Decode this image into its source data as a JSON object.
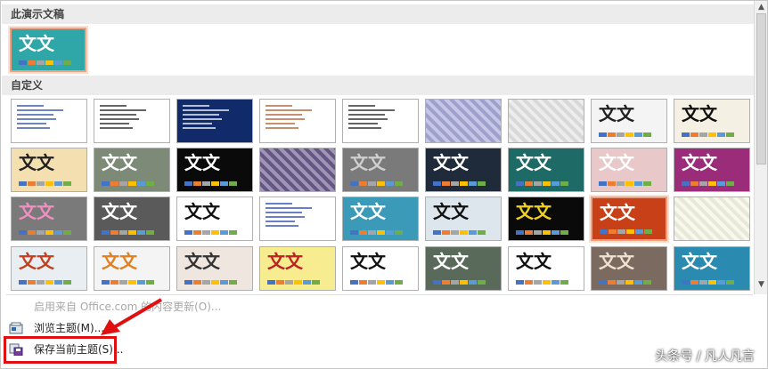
{
  "sections": {
    "current": "此演示文稿",
    "custom": "自定义"
  },
  "current_theme": {
    "text": "文文",
    "bg": "#2fa6a8",
    "color": "#ffffff"
  },
  "themes": [
    {
      "kind": "lines",
      "bg": "#ffffff",
      "line": "#3050a0"
    },
    {
      "kind": "lines",
      "bg": "#ffffff",
      "line": "#222222"
    },
    {
      "kind": "lines",
      "bg": "#102a6a",
      "line": "#ffffff"
    },
    {
      "kind": "lines",
      "bg": "#ffffff",
      "line": "#b06030"
    },
    {
      "kind": "lines",
      "bg": "#ffffff",
      "line": "#222222"
    },
    {
      "kind": "pattern",
      "bg": "#a8a8d8"
    },
    {
      "kind": "pattern",
      "bg": "#e4e4e4"
    },
    {
      "kind": "text",
      "text": "文文",
      "bg": "#f4f4f4",
      "color": "#222222"
    },
    {
      "kind": "text",
      "text": "文文",
      "bg": "#f4f0e4",
      "color": "#111111"
    },
    {
      "kind": "text",
      "text": "文文",
      "bg": "#f3dfb0",
      "color": "#222222"
    },
    {
      "kind": "text",
      "text": "文文",
      "bg": "#7e8a78",
      "color": "#ffffff"
    },
    {
      "kind": "text",
      "text": "文文",
      "bg": "#0a0a0a",
      "color": "#ffffff"
    },
    {
      "kind": "pattern",
      "bg": "#6a5a8a"
    },
    {
      "kind": "text",
      "text": "文文",
      "bg": "#7a7a7a",
      "color": "#cfcfcf"
    },
    {
      "kind": "text",
      "text": "文文",
      "bg": "#1f2a3a",
      "color": "#ffffff"
    },
    {
      "kind": "text",
      "text": "文文",
      "bg": "#1e6a66",
      "color": "#ffffff"
    },
    {
      "kind": "text",
      "text": "文文",
      "bg": "#e8c8c8",
      "color": "#ffffff"
    },
    {
      "kind": "text",
      "text": "文文",
      "bg": "#9a2c7a",
      "color": "#ffffff"
    },
    {
      "kind": "text",
      "text": "文文",
      "bg": "#7a7a7a",
      "color": "#f090c0"
    },
    {
      "kind": "text",
      "text": "文文",
      "bg": "#5a5a5a",
      "color": "#ffffff"
    },
    {
      "kind": "text",
      "text": "文文",
      "bg": "#ffffff",
      "color": "#111111"
    },
    {
      "kind": "lines",
      "bg": "#ffffff",
      "line": "#2a4ab0"
    },
    {
      "kind": "text",
      "text": "文文",
      "bg": "#3a9ab8",
      "color": "#ffffff"
    },
    {
      "kind": "text",
      "text": "文文",
      "bg": "#dce6ec",
      "color": "#111111"
    },
    {
      "kind": "text",
      "text": "文文",
      "bg": "#0a0a0a",
      "color": "#f0d020"
    },
    {
      "kind": "text",
      "text": "文文",
      "bg": "#c84018",
      "color": "#ffffff"
    },
    {
      "kind": "pattern",
      "bg": "#f4f4e4"
    },
    {
      "kind": "text",
      "text": "文文",
      "bg": "#e8eef2",
      "color": "#c04020"
    },
    {
      "kind": "text",
      "text": "文文",
      "bg": "#f4f4f4",
      "color": "#e08020"
    },
    {
      "kind": "text",
      "text": "文文",
      "bg": "#f0e6e0",
      "color": "#333333"
    },
    {
      "kind": "text",
      "text": "文文",
      "bg": "#f8ec90",
      "color": "#c02020"
    },
    {
      "kind": "text",
      "text": "文文",
      "bg": "#ffffff",
      "color": "#111111"
    },
    {
      "kind": "text",
      "text": "文文",
      "bg": "#5a6a5a",
      "color": "#ffffff"
    },
    {
      "kind": "text",
      "text": "文文",
      "bg": "#ffffff",
      "color": "#111111"
    },
    {
      "kind": "text",
      "text": "文文",
      "bg": "#7a6a60",
      "color": "#f0e0d0"
    },
    {
      "kind": "text",
      "text": "文文",
      "bg": "#2a8ab0",
      "color": "#ffffff"
    }
  ],
  "swatch_colors": [
    "#4472c4",
    "#ed7d31",
    "#a5a5a5",
    "#ffc000",
    "#5b9bd5",
    "#70ad47"
  ],
  "scroll": {
    "up": "▲",
    "down": "▼"
  },
  "menu": {
    "update": "启用来自 Office.com 的内容更新(O)...",
    "browse": "浏览主题(M)...",
    "save": "保存当前主题(S)..."
  },
  "watermark": "头条号 / 凡人凡言",
  "annotation_color": "#e01010"
}
